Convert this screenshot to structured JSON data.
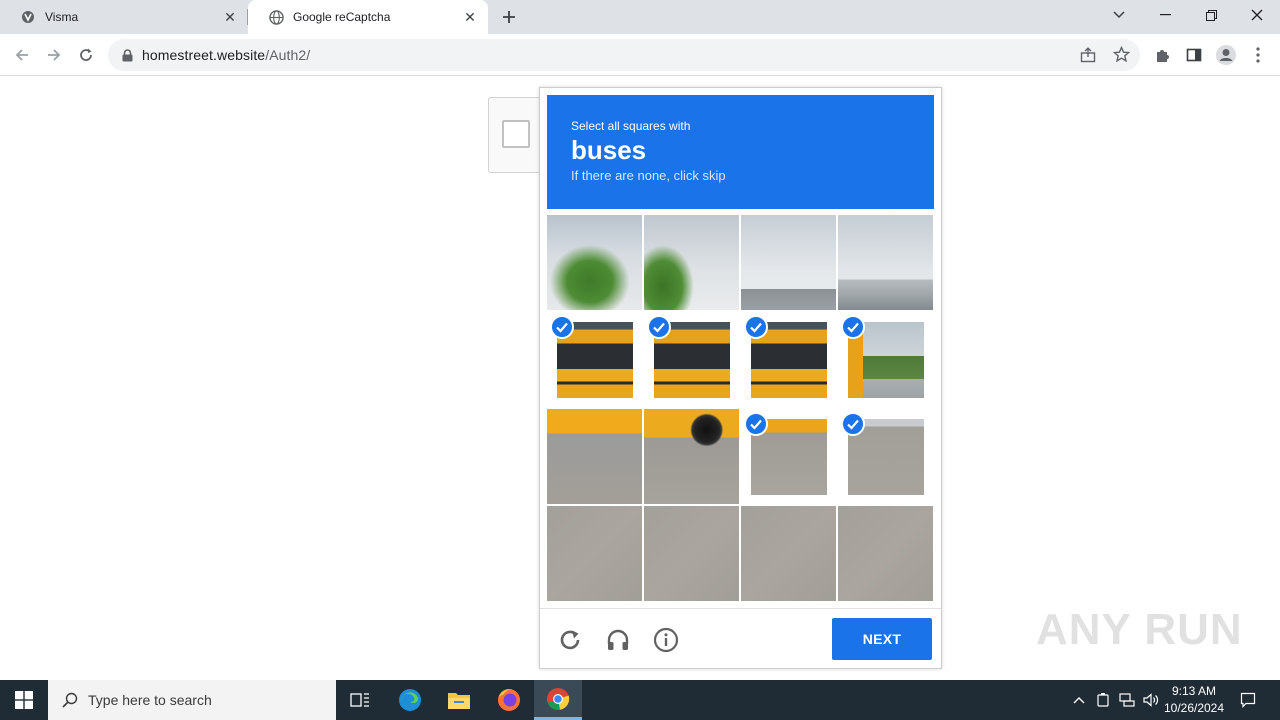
{
  "browser": {
    "tabs": [
      {
        "title": "Visma",
        "favicon": "visma-icon",
        "active": false
      },
      {
        "title": "Google reCaptcha",
        "favicon": "globe-icon",
        "active": true
      }
    ],
    "url_host": "homestreet.website",
    "url_path": "/Auth2/"
  },
  "captcha": {
    "instruction_line1": "Select all squares with",
    "target": "buses",
    "instruction_line3": "If there are none, click skip",
    "grid": [
      {
        "tile": "sky-tree",
        "selected": false
      },
      {
        "tile": "sky-tree2",
        "selected": false
      },
      {
        "tile": "sky-bld",
        "selected": false
      },
      {
        "tile": "sky-bld2",
        "selected": false
      },
      {
        "tile": "bus",
        "selected": true
      },
      {
        "tile": "bus",
        "selected": true
      },
      {
        "tile": "bus",
        "selected": true
      },
      {
        "tile": "bus-end",
        "selected": true
      },
      {
        "tile": "bus-low",
        "selected": false
      },
      {
        "tile": "bus-wheel",
        "selected": false
      },
      {
        "tile": "bus-low2",
        "selected": true
      },
      {
        "tile": "road-top",
        "selected": true
      },
      {
        "tile": "road",
        "selected": false
      },
      {
        "tile": "road",
        "selected": false
      },
      {
        "tile": "road",
        "selected": false
      },
      {
        "tile": "road",
        "selected": false
      }
    ],
    "next_label": "NEXT",
    "footer_icons": [
      "reload-icon",
      "audio-icon",
      "info-icon"
    ],
    "accent_color": "#1a73e8"
  },
  "watermark": "ANY RUN",
  "taskbar": {
    "search_placeholder": "Type here to search",
    "time": "9:13 AM",
    "date": "10/26/2024"
  }
}
